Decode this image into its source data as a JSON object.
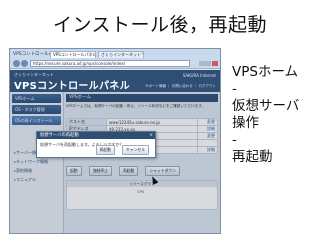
{
  "slide": {
    "title": "インストール後，再起動",
    "steps": [
      "VPSホーム",
      "-",
      "仮想サーバ",
      "操作",
      "-",
      "再起動"
    ]
  },
  "browser": {
    "window_title": "VPSコントロールパネル",
    "tabs": [
      "VPSコントロールパネル",
      "さくらインターネット VPS"
    ],
    "address": "https://secure.sakura.ad.jp/vps/console/index/"
  },
  "app": {
    "brand": "さくらインターネット",
    "title": "VPSコントロールパネル",
    "logo_text": "SAKURA Internet",
    "header_nav": "サポート情報 ｜ お問い合わせ ｜ ログアウト"
  },
  "sidebar": {
    "items": [
      {
        "label": "VPSホーム",
        "active": false
      },
      {
        "label": "OS・タスク管理",
        "active": false
      },
      {
        "label": "OSの再インストール",
        "active": true
      }
    ],
    "links": [
      "サーバー情報",
      "ネットワーク情報",
      "契約情報",
      "マニュアル"
    ]
  },
  "main": {
    "section_title": "VPSホーム",
    "info_text": "VPSホームでは、仮想サーバの起動・停止、リソース状況などをご確認いただけます。",
    "rows": [
      {
        "key": "ホスト名",
        "value": "www12345u.sakura.ne.jp",
        "action": "変更"
      },
      {
        "key": "IPアドレス",
        "value": "49.212.xx.xx",
        "action": "詳細"
      },
      {
        "key": "プラン",
        "value": "512",
        "action": "変更"
      },
      {
        "key": "OS",
        "value": "CentOS",
        "action": ""
      },
      {
        "key": "ステータス",
        "value": "稼働中",
        "action": "詳細"
      }
    ],
    "buttons": [
      "起動",
      "強制停止",
      "再起動",
      "シャットダウン"
    ],
    "graph_title": "リソースグラフ",
    "graph_label": "CPU"
  },
  "dialog": {
    "title": "仮想サーバの再起動",
    "message": "仮想サーバを再起動します。よろしいですか？",
    "ok_label": "再起動",
    "cancel_label": "キャンセル"
  }
}
